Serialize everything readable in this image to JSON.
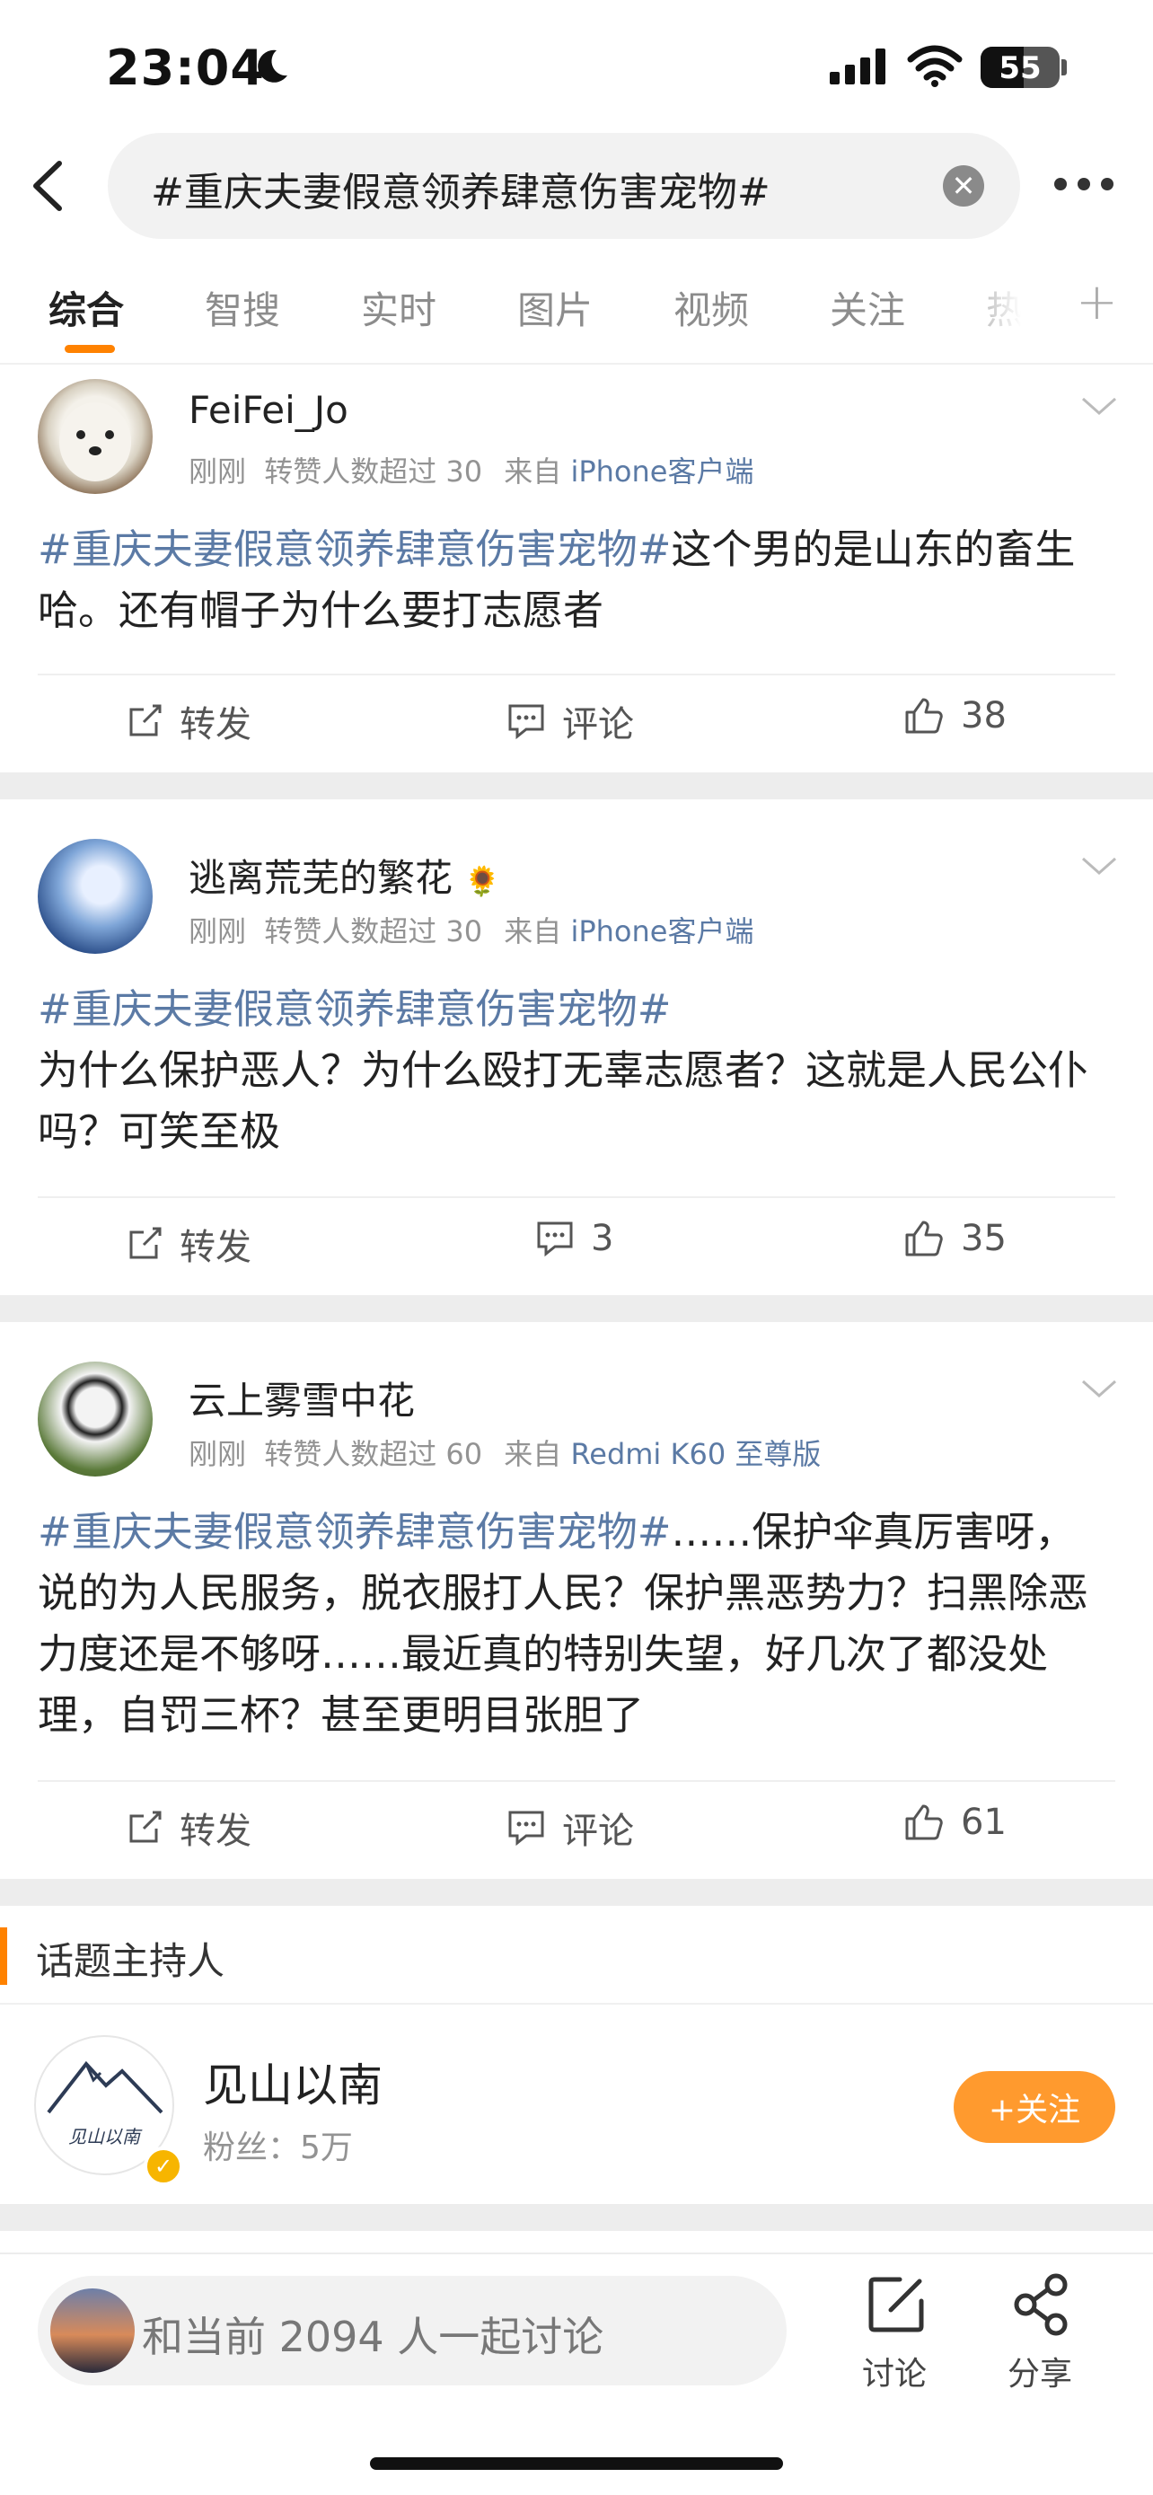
{
  "status_bar": {
    "time": "23:04",
    "battery": "55"
  },
  "search": {
    "query": "#重庆夫妻假意领养肆意伤害宠物#"
  },
  "tabs": [
    {
      "label": "综合",
      "active": true
    },
    {
      "label": "智搜"
    },
    {
      "label": "实时"
    },
    {
      "label": "图片"
    },
    {
      "label": "视频"
    },
    {
      "label": "关注"
    },
    {
      "label": "热"
    }
  ],
  "posts": [
    {
      "author": "FeiFei_Jo",
      "time": "刚刚",
      "reposts_info": "转赞人数超过 30",
      "source_prefix": "来自",
      "source": "iPhone客户端",
      "topic": "#重庆夫妻假意领养肆意伤害宠物#",
      "text": "这个男的是山东的畜生哈。还有帽子为什么要打志愿者",
      "repost_label": "转发",
      "comment_label": "评论",
      "likes": "38"
    },
    {
      "author": "逃离荒芜的繁花",
      "author_badge": "🌻",
      "time": "刚刚",
      "reposts_info": "转赞人数超过 30",
      "source_prefix": "来自",
      "source": "iPhone客户端",
      "topic": "#重庆夫妻假意领养肆意伤害宠物#",
      "text": "为什么保护恶人？为什么殴打无辜志愿者？这就是人民公仆吗？可笑至极",
      "repost_label": "转发",
      "comment_label": "3",
      "likes": "35"
    },
    {
      "author": "云上雾雪中花",
      "time": "刚刚",
      "reposts_info": "转赞人数超过 60",
      "source_prefix": "来自",
      "source": "Redmi K60 至尊版",
      "topic": "#重庆夫妻假意领养肆意伤害宠物#",
      "text": "……保护伞真厉害呀，说的为人民服务，脱衣服打人民？保护黑恶势力？扫黑除恶力度还是不够呀……最近真的特别失望，好几次了都没处理，自罚三杯？甚至更明目张胆了",
      "repost_label": "转发",
      "comment_label": "评论",
      "likes": "61"
    }
  ],
  "host_section": {
    "title": "话题主持人",
    "name": "见山以南",
    "fans": "粉丝：5万",
    "follow_label": "+关注",
    "avatar_text": "见山以南"
  },
  "bottom_bar": {
    "discuss_placeholder": "和当前 2094 人一起讨论",
    "discuss_label": "讨论",
    "share_label": "分享"
  },
  "colors": {
    "accent": "#ff8200",
    "link": "#5b7aa5",
    "follow": "#ff9a2e"
  }
}
